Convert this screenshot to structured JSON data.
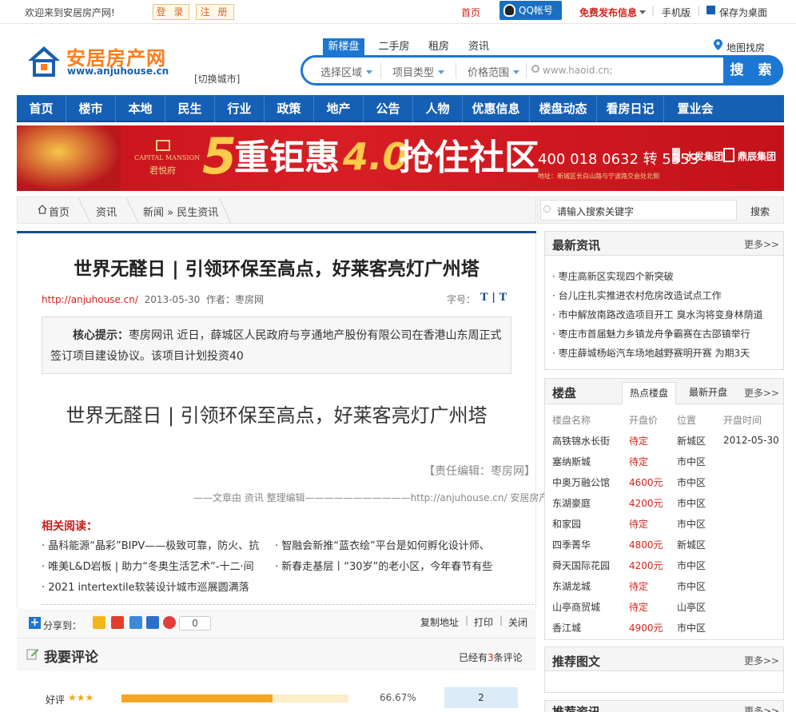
{
  "topbar": {
    "welcome": "欢迎来到安居房产网!",
    "login": "登 录",
    "register": "注 册",
    "home": "首页",
    "qq": "QQ帐号",
    "free_publish": "免费发布信息",
    "mobile": "手机版",
    "save_desktop": "保存为桌面"
  },
  "logo": {
    "cn": "安居房产网",
    "en": "www.anjuhouse.cn",
    "switch_city": "[切换城市]",
    "map": "地图找房"
  },
  "search": {
    "tabs": [
      "新楼盘",
      "二手房",
      "租房",
      "资讯"
    ],
    "region": "选择区域",
    "type": "项目类型",
    "price": "价格范围",
    "placeholder": "www.haoid.cn;",
    "button": "搜 索"
  },
  "nav": [
    "首页",
    "楼市",
    "本地",
    "民生",
    "行业",
    "政策",
    "地产",
    "公告",
    "人物",
    "优惠信息",
    "楼盘动态",
    "看房日记",
    "置业会"
  ],
  "banner": {
    "brand_en": "CAPITAL MANSION",
    "brand_cn": "君悦府",
    "big1": "5",
    "big2": "重钜惠",
    "big3": "4.0",
    "big4": "抢住社区",
    "phone": "400 018 0632 转 5353",
    "g1": "水发集团",
    "g2": "鼎辰集团",
    "addr": "地址：新城区长白山路与宁波路交会处北侧"
  },
  "breadcrumb": {
    "home": "首页",
    "l1": "资讯",
    "l2": "新闻 » 民生资讯",
    "search_placeholder": "请输入搜索关键字",
    "search_btn": "搜索"
  },
  "article": {
    "title": "世界无醛日 | 引领环保至高点，好莱客亮灯广州塔",
    "url": "http://anjuhouse.cn/",
    "date": "2013-05-30",
    "author": "作者：枣房网",
    "font_label": "字号：",
    "font_t": "T | T",
    "summary_label": "核心提示：",
    "summary": "枣房网讯 近日，薛城区人民政府与亨通地产股份有限公司在香港山东周正式签订项目建设协议。该项目计划投资40",
    "body_heading": "世界无醛日 | 引领环保至高点，好莱客亮灯广州塔",
    "editor": "【责任编辑：枣房网】",
    "source": "——文章由 资讯 整理编辑———————————http://anjuhouse.cn/ 安居房产网",
    "related_title": "相关阅读：",
    "related": [
      "· 晶科能源“晶彩”BIPV——极致可靠，防火、抗",
      "· 智融会新推“蓝衣绘”平台是如何孵化设计师、",
      "· 唯美L&D岩板 | 助力“冬奥生活艺术”-十二·间",
      "· 新春走基层丨“30岁”的老小区，今年春节有些",
      "· 2021 intertextile软装设计城市巡展圆满落"
    ]
  },
  "share": {
    "label": "分享到：",
    "count": "0",
    "copy": "复制地址",
    "print": "打印",
    "close": "关闭"
  },
  "comment": {
    "title": "我要评论",
    "count_prefix": "已经有",
    "count": "3",
    "count_suffix": "条评论",
    "good": "好评",
    "stars": "★★★",
    "percent": "66.67%",
    "num": "2"
  },
  "sidebar": {
    "news_title": "最新资讯",
    "more": "更多>>",
    "news": [
      "· 枣庄高新区实现四个新突破",
      "· 台儿庄扎实推进农村危房改造试点工作",
      "· 市中解放南路改造项目开工 臭水沟将变身林荫道",
      "· 枣庄市首届魅力乡镇龙舟争霸赛在古邵镇举行",
      "· 枣庄薛城杨峪汽车场地越野赛明开赛 为期3天"
    ],
    "lp_title": "楼盘",
    "lp_tab1": "热点楼盘",
    "lp_tab2": "最新开盘",
    "lp_cols": [
      "楼盘名称",
      "开盘价",
      "位置",
      "开盘时间"
    ],
    "lp_rows": [
      [
        "高铁锦水长街",
        "待定",
        "新城区",
        "2012-05-30"
      ],
      [
        "塞纳斯城",
        "待定",
        "市中区",
        ""
      ],
      [
        "中奥万融公馆",
        "4600元",
        "市中区",
        ""
      ],
      [
        "东湖豪庭",
        "4200元",
        "市中区",
        ""
      ],
      [
        "和家园",
        "待定",
        "市中区",
        ""
      ],
      [
        "四季菁华",
        "4800元",
        "新城区",
        ""
      ],
      [
        "舜天国际花园",
        "4200元",
        "市中区",
        ""
      ],
      [
        "东湖龙城",
        "待定",
        "市中区",
        ""
      ],
      [
        "山亭商贸城",
        "待定",
        "山亭区",
        ""
      ],
      [
        "香江城",
        "4900元",
        "市中区",
        ""
      ]
    ],
    "img_title": "推荐图文",
    "rec_title": "推荐资讯"
  },
  "colors": {
    "brand_blue": "#1560b5",
    "orange": "#ff7c1c",
    "red": "#d4241b"
  }
}
